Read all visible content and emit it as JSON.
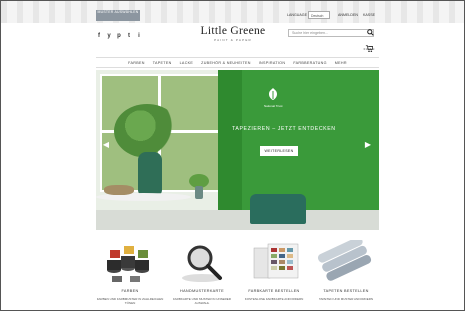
{
  "topbar": {
    "promo": "MUSTER AUSWÄHLEN",
    "language_label": "LANGUAGE",
    "language_value": "Deutsch",
    "account": "ANMELDEN",
    "cart": "KASSE"
  },
  "social": [
    "f",
    "y",
    "p",
    "t",
    "i"
  ],
  "brand": {
    "name": "Little Greene",
    "tagline": "PAINT & PAPER"
  },
  "search": {
    "placeholder": "Suche hier eingeben...",
    "cart_label": "0 Artikel"
  },
  "nav": [
    "FARBEN",
    "TAPETEN",
    "LACKE",
    "ZUBEHÖR & NEUHEITEN",
    "INSPIRATION",
    "FARBBERATUNG",
    "MEHR"
  ],
  "hero": {
    "partner_text": "National Trust",
    "headline": "TAPEZIEREN – JETZT ENTDECKEN",
    "cta": "WEITERLESEN",
    "colors": {
      "green": "#3a9a3a",
      "vase": "#2f6e57"
    }
  },
  "categories": [
    {
      "label": "FARBEN",
      "desc": "FARBEN UND FARBMUSTER IN ZAHLREICHEN TÖNEN"
    },
    {
      "label": "HANDMUSTERKARTE",
      "desc": "FARBKARTE UND MUSTER IN UNSERER AUSWAHL"
    },
    {
      "label": "FARBKARTE BESTELLEN",
      "desc": "KOSTENLOSE FARBKARTE ANFORDERN"
    },
    {
      "label": "TAPETEN BESTELLEN",
      "desc": "TAPETEN UND MUSTER ANFORDERN"
    }
  ]
}
